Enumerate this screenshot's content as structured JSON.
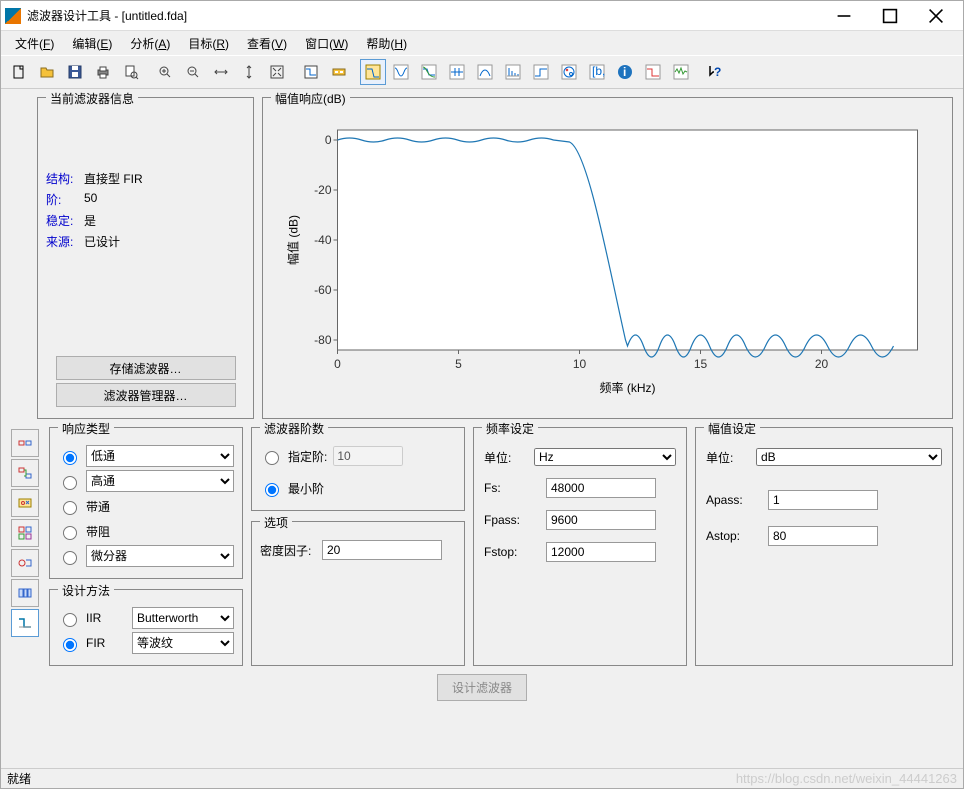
{
  "window": {
    "title": "滤波器设计工具 - [untitled.fda]"
  },
  "menu": {
    "file": "文件(F)",
    "edit": "编辑(E)",
    "analysis": "分析(A)",
    "target": "目标(R)",
    "view": "查看(V)",
    "window": "窗口(W)",
    "help": "帮助(H)"
  },
  "info": {
    "legend": "当前滤波器信息",
    "struct_lbl": "结构:",
    "struct_val": "直接型 FIR",
    "order_lbl": "阶:",
    "order_val": "50",
    "stable_lbl": "稳定:",
    "stable_val": "是",
    "source_lbl": "来源:",
    "source_val": "已设计",
    "store_btn": "存储滤波器…",
    "mgr_btn": "滤波器管理器…"
  },
  "chart": {
    "legend": "幅值响应(dB)",
    "ylabel": "幅值 (dB)",
    "xlabel": "频率 (kHz)"
  },
  "chart_data": {
    "type": "line",
    "title": "幅值响应(dB)",
    "xlabel": "频率 (kHz)",
    "ylabel": "幅值 (dB)",
    "xlim": [
      0,
      24
    ],
    "ylim": [
      -90,
      5
    ],
    "xticks": [
      0,
      5,
      10,
      15,
      20
    ],
    "yticks": [
      0,
      -20,
      -40,
      -60,
      -80
    ],
    "series": [
      {
        "name": "Magnitude",
        "segments": [
          {
            "desc": "passband ripple",
            "x_range": [
              0,
              9.6
            ],
            "y_approx": 0,
            "ripple_pk": 1
          },
          {
            "desc": "transition",
            "x_from": 9.6,
            "y_from": 0,
            "x_to": 12,
            "y_to": -80
          },
          {
            "desc": "stopband ripple",
            "x_range": [
              12,
              24
            ],
            "y_approx": -83,
            "ripple_pk": 8,
            "lobe_count": 14
          }
        ]
      }
    ]
  },
  "resp": {
    "legend": "响应类型",
    "low": "低通",
    "high": "高通",
    "band": "带通",
    "stop": "带阻",
    "diff": "微分器"
  },
  "method": {
    "legend": "设计方法",
    "iir": "IIR",
    "fir": "FIR",
    "iir_sel": "Butterworth",
    "fir_sel": "等波纹"
  },
  "order": {
    "legend": "滤波器阶数",
    "spec": "指定阶:",
    "spec_val": "10",
    "min": "最小阶"
  },
  "options": {
    "legend": "选项",
    "density": "密度因子:",
    "density_val": "20"
  },
  "freq": {
    "legend": "频率设定",
    "unit_lbl": "单位:",
    "unit_val": "Hz",
    "fs_lbl": "Fs:",
    "fs_val": "48000",
    "fpass_lbl": "Fpass:",
    "fpass_val": "9600",
    "fstop_lbl": "Fstop:",
    "fstop_val": "12000"
  },
  "mag": {
    "legend": "幅值设定",
    "unit_lbl": "单位:",
    "unit_val": "dB",
    "apass_lbl": "Apass:",
    "apass_val": "1",
    "astop_lbl": "Astop:",
    "astop_val": "80"
  },
  "design_btn": "设计滤波器",
  "status": "就绪",
  "watermark": "https://blog.csdn.net/weixin_44441263"
}
